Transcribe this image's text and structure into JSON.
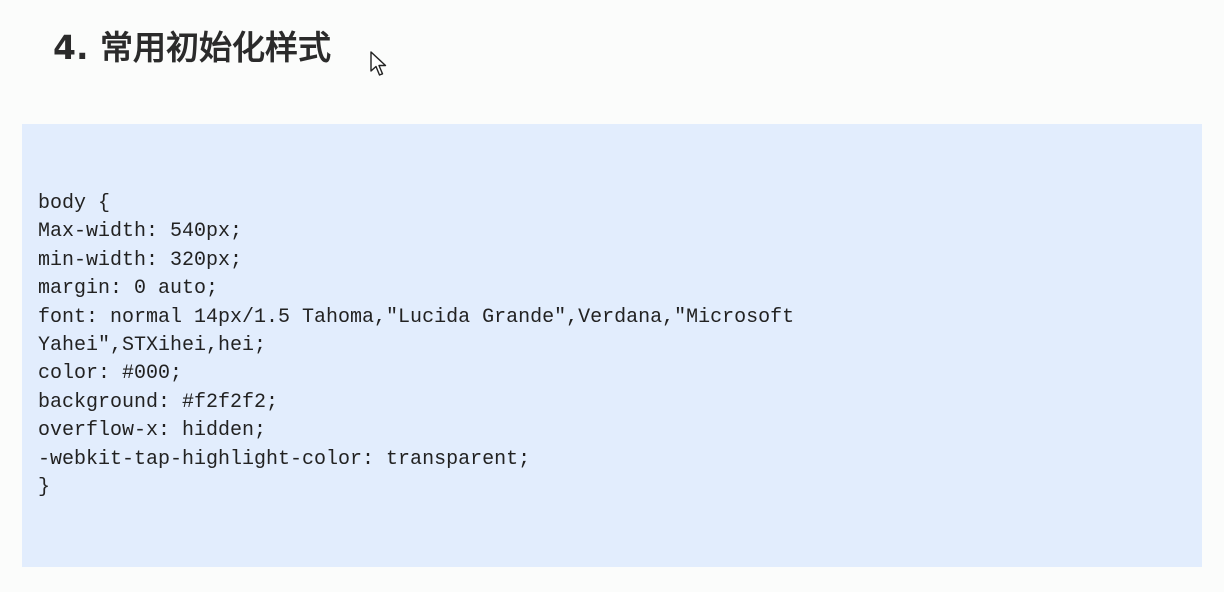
{
  "heading": {
    "title": "4. 常用初始化样式"
  },
  "cursor": {
    "icon": "arrow-pointer-icon"
  },
  "code": {
    "lines": [
      "body {",
      "Max-width: 540px;",
      "min-width: 320px;",
      "margin: 0 auto;",
      "font: normal 14px/1.5 Tahoma,\"Lucida Grande\",Verdana,\"Microsoft",
      "Yahei\",STXihei,hei;",
      "color: #000;",
      "background: #f2f2f2;",
      "overflow-x: hidden;",
      "-webkit-tap-highlight-color: transparent;",
      "}"
    ]
  },
  "colors": {
    "page_background": "#fbfcfb",
    "code_background": "#e2edfd",
    "heading_text": "#2b2b2b",
    "code_text": "#222222"
  }
}
